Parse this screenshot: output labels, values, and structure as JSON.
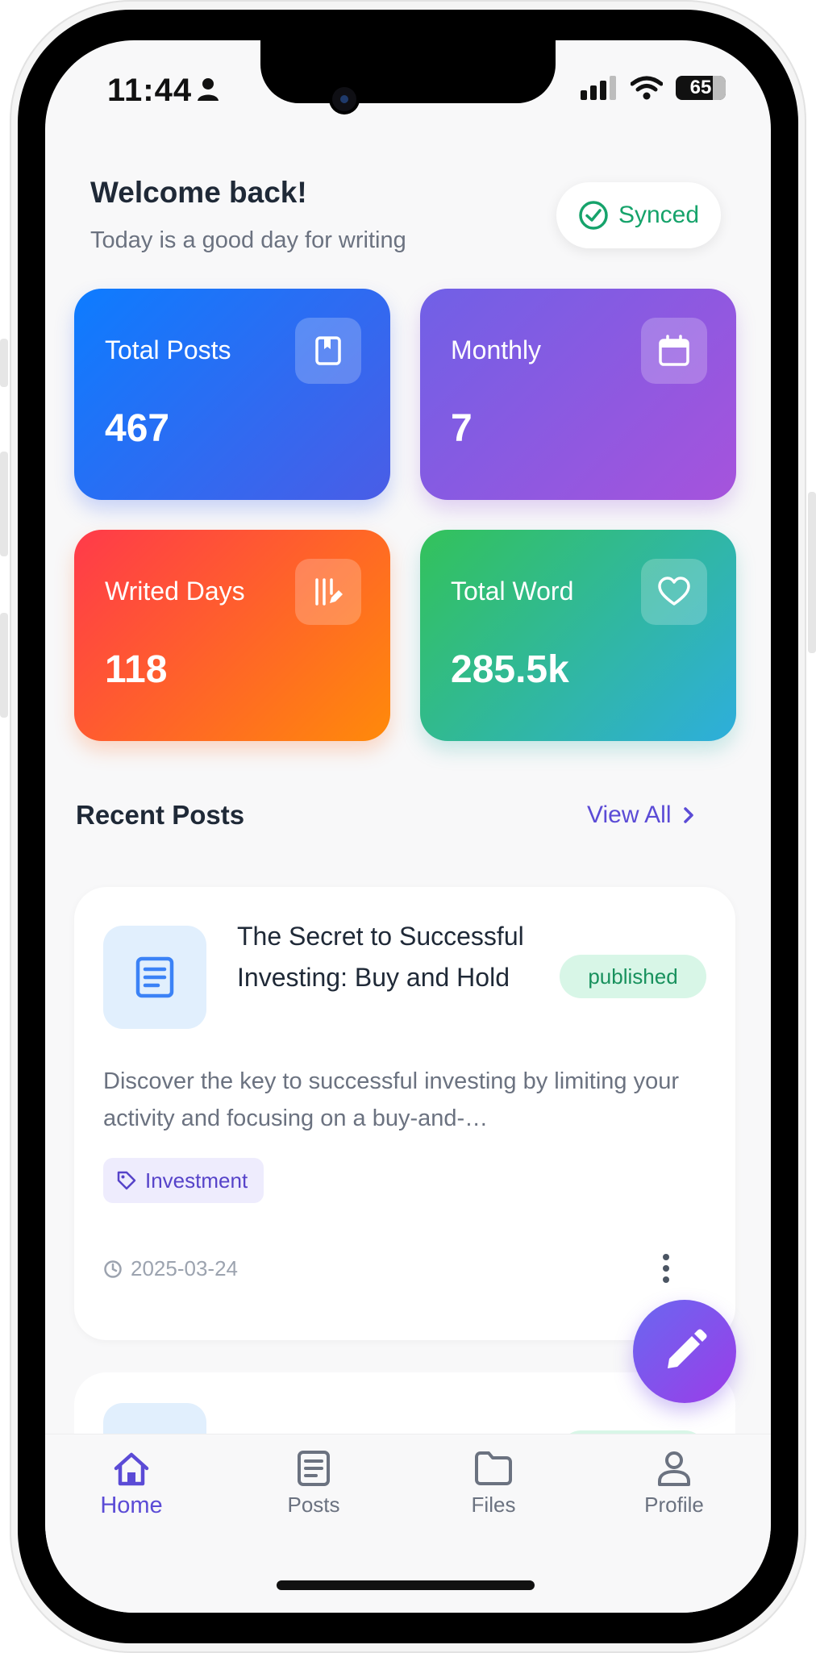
{
  "status_bar": {
    "time": "11:44",
    "battery": "65"
  },
  "header": {
    "welcome": "Welcome back!",
    "subtitle": "Today is a good day for writing",
    "sync_label": "Synced"
  },
  "stats": [
    {
      "label": "Total Posts",
      "value": "467",
      "icon": "bookmark-icon"
    },
    {
      "label": "Monthly",
      "value": "7",
      "icon": "calendar-icon"
    },
    {
      "label": "Writed Days",
      "value": "118",
      "icon": "writing-days-icon"
    },
    {
      "label": "Total Word",
      "value": "285.5k",
      "icon": "heart-icon"
    }
  ],
  "recent": {
    "title": "Recent Posts",
    "view_all": "View All"
  },
  "posts": [
    {
      "title": "The Secret to Successful Investing: Buy and Hold",
      "status": "published",
      "description": "Discover the key to successful investing by limiting your activity and focusing on a buy-and-…",
      "tag": "Investment",
      "date": "2025-03-24"
    }
  ],
  "tabs": [
    {
      "label": "Home",
      "icon": "home-icon",
      "active": true
    },
    {
      "label": "Posts",
      "icon": "document-icon",
      "active": false
    },
    {
      "label": "Files",
      "icon": "folder-icon",
      "active": false
    },
    {
      "label": "Profile",
      "icon": "person-icon",
      "active": false
    }
  ],
  "colors": {
    "accent": "#5b4bd6",
    "success": "#16a36b",
    "background": "#f8f8f9"
  }
}
